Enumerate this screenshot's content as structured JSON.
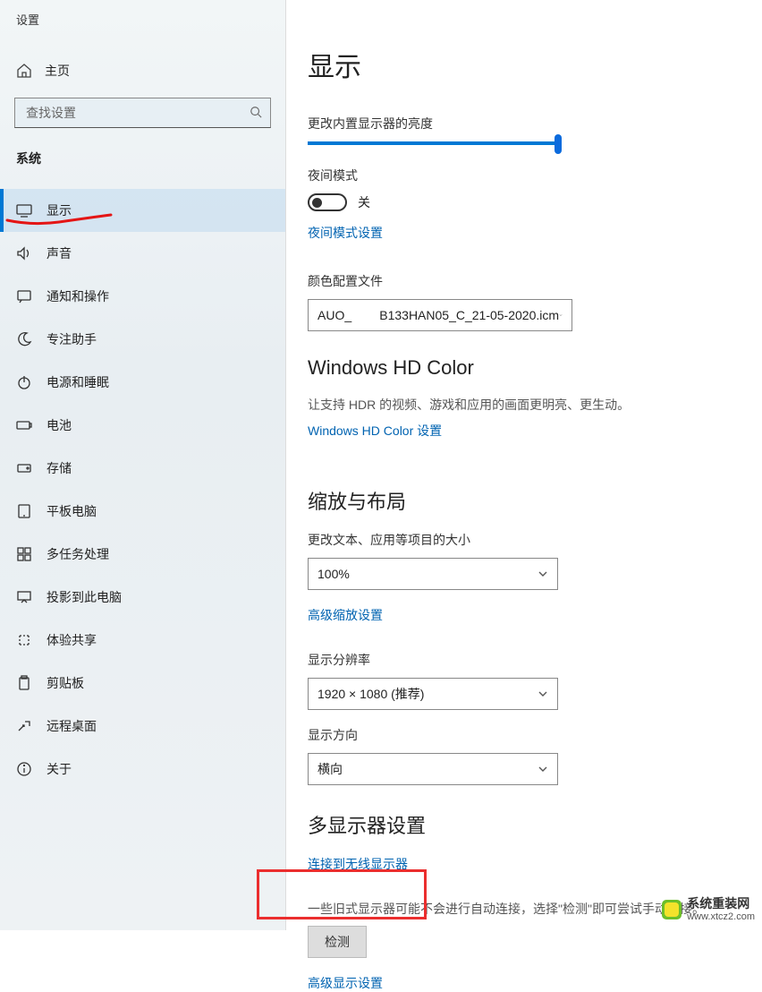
{
  "header": {
    "settings": "设置"
  },
  "sidebar": {
    "home": "主页",
    "searchPlaceholder": "查找设置",
    "section": "系统",
    "items": [
      {
        "label": "显示",
        "icon": "display"
      },
      {
        "label": "声音",
        "icon": "sound"
      },
      {
        "label": "通知和操作",
        "icon": "notify"
      },
      {
        "label": "专注助手",
        "icon": "focus"
      },
      {
        "label": "电源和睡眠",
        "icon": "power"
      },
      {
        "label": "电池",
        "icon": "battery"
      },
      {
        "label": "存储",
        "icon": "storage"
      },
      {
        "label": "平板电脑",
        "icon": "tablet"
      },
      {
        "label": "多任务处理",
        "icon": "multitask"
      },
      {
        "label": "投影到此电脑",
        "icon": "project"
      },
      {
        "label": "体验共享",
        "icon": "share"
      },
      {
        "label": "剪贴板",
        "icon": "clipboard"
      },
      {
        "label": "远程桌面",
        "icon": "remote"
      },
      {
        "label": "关于",
        "icon": "about"
      }
    ]
  },
  "main": {
    "title": "显示",
    "brightnessLabel": "更改内置显示器的亮度",
    "nightModeLabel": "夜间模式",
    "nightModeState": "关",
    "nightModeLink": "夜间模式设置",
    "colorProfileLabel": "颜色配置文件",
    "colorProfileValue": "AUO_        B133HAN05_C_21-05-2020.icm",
    "hdTitle": "Windows HD Color",
    "hdDesc": "让支持 HDR 的视频、游戏和应用的画面更明亮、更生动。",
    "hdLink": "Windows HD Color 设置",
    "scaleTitle": "缩放与布局",
    "scaleLabel": "更改文本、应用等项目的大小",
    "scaleValue": "100%",
    "scaleLink": "高级缩放设置",
    "resLabel": "显示分辨率",
    "resValue": "1920 × 1080 (推荐)",
    "orientLabel": "显示方向",
    "orientValue": "横向",
    "multiTitle": "多显示器设置",
    "multiLink": "连接到无线显示器",
    "multiDesc": "一些旧式显示器可能不会进行自动连接，选择\"检测\"即可尝试手动连接。",
    "detectBtn": "检测",
    "advLink": "高级显示设置"
  },
  "watermark": {
    "line1": "系统重装网",
    "line2": "www.xtcz2.com"
  }
}
